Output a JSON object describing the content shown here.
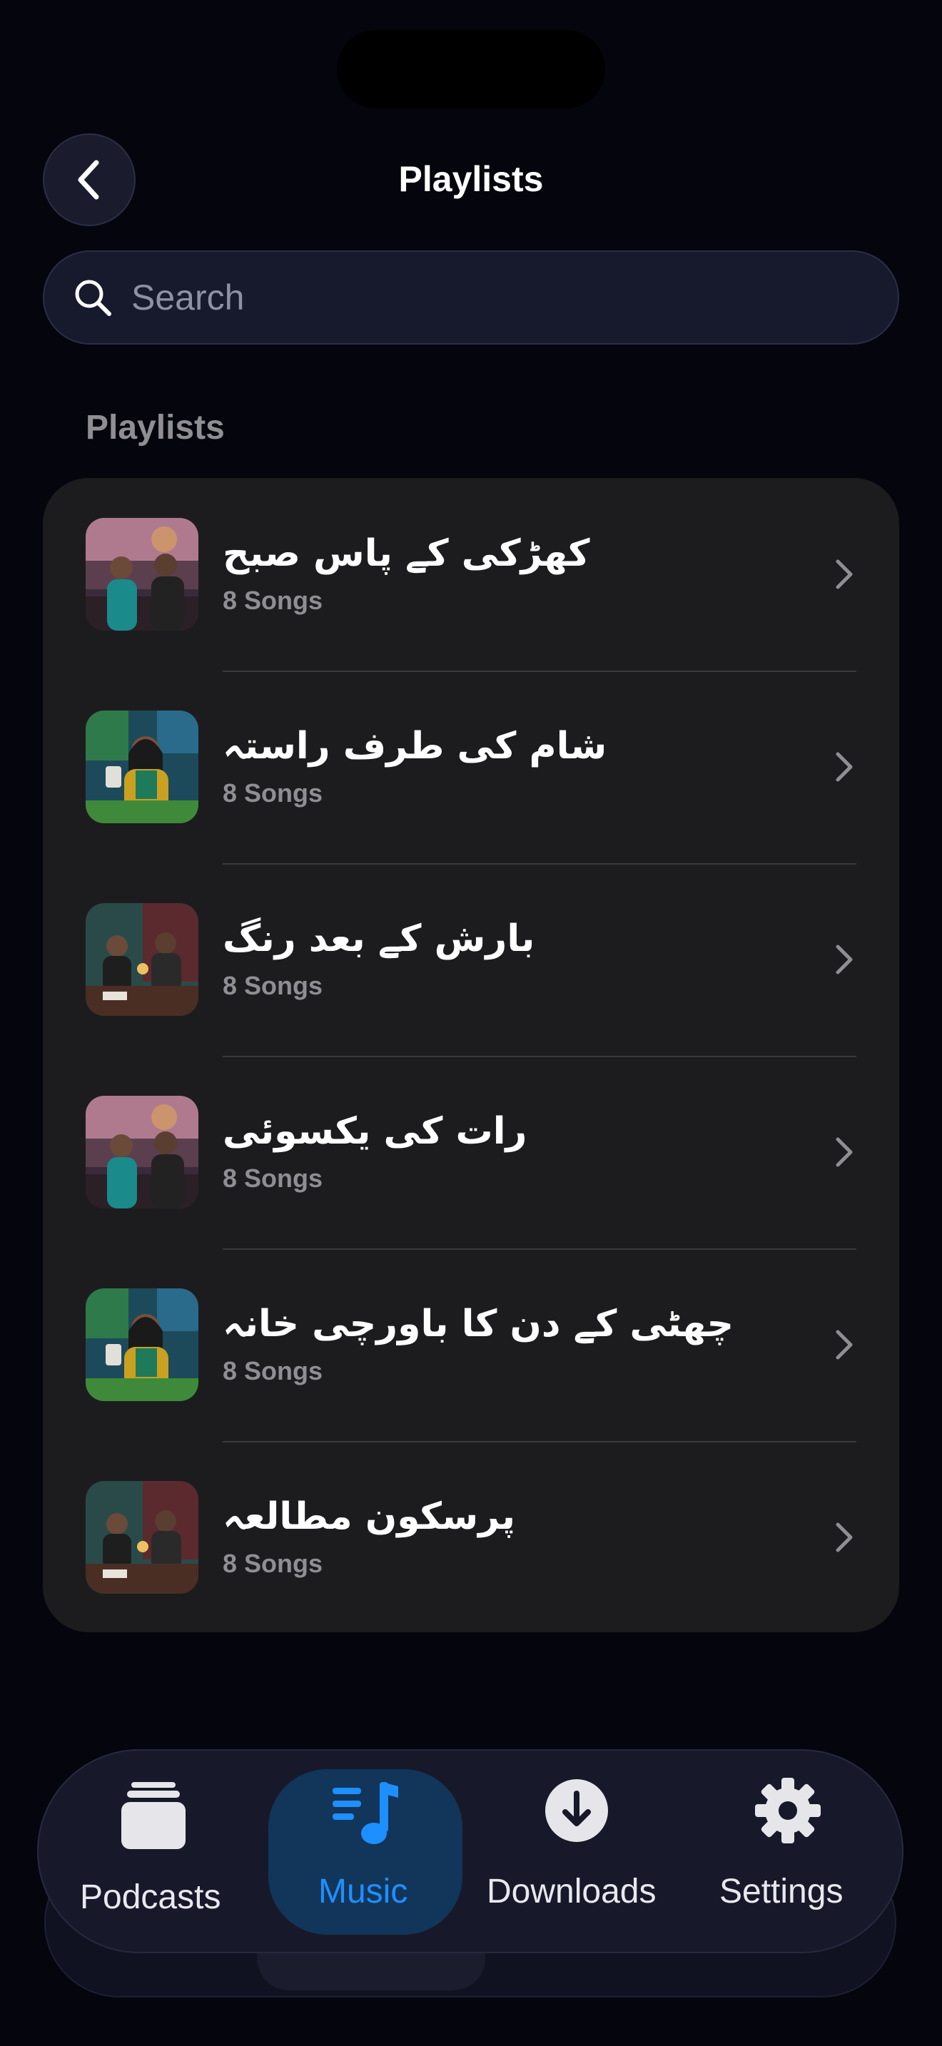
{
  "header": {
    "title": "Playlists",
    "back_icon": "chevron-left-icon"
  },
  "search": {
    "placeholder": "Search",
    "value": ""
  },
  "section": {
    "label": "Playlists"
  },
  "playlists": [
    {
      "title": "کھڑکی کے پاس صبح",
      "subtitle": "8 Songs",
      "art": "street-duo"
    },
    {
      "title": "شام کی طرف راستہ",
      "subtitle": "8 Songs",
      "art": "cafe-woman"
    },
    {
      "title": "بارش کے بعد رنگ",
      "subtitle": "8 Songs",
      "art": "studio-duo"
    },
    {
      "title": "رات کی یکسوئی",
      "subtitle": "8 Songs",
      "art": "street-duo"
    },
    {
      "title": "چھٹی کے دن کا باورچی خانہ",
      "subtitle": "8 Songs",
      "art": "cafe-woman"
    },
    {
      "title": "پرسکون مطالعہ",
      "subtitle": "8 Songs",
      "art": "studio-duo"
    }
  ],
  "tabbar": {
    "tabs": [
      {
        "label": "Podcasts",
        "icon": "podcast-stack-icon",
        "active": false
      },
      {
        "label": "Music",
        "icon": "music-note-icon",
        "active": true
      },
      {
        "label": "Downloads",
        "icon": "download-circle-icon",
        "active": false
      },
      {
        "label": "Settings",
        "icon": "gear-icon",
        "active": false
      }
    ]
  },
  "colors": {
    "background": "#05050e",
    "card": "#1c1c1e",
    "accent": "#1e8fff",
    "secondary_text": "#8e8e93"
  }
}
